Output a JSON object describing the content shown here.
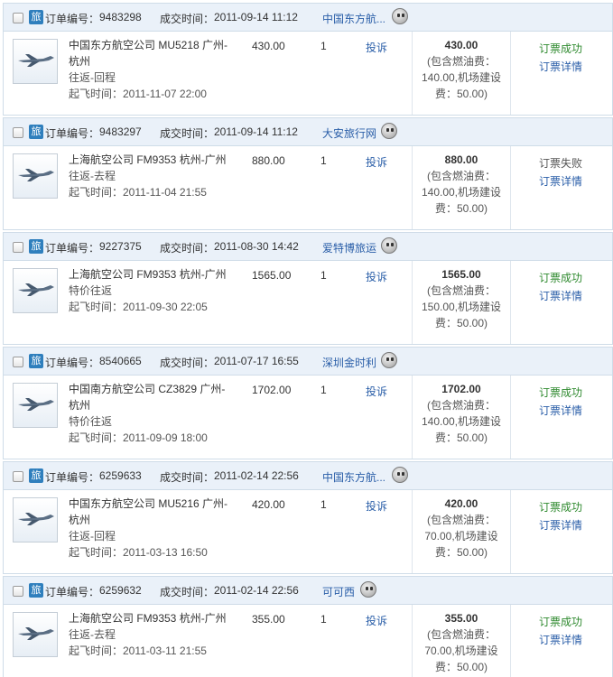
{
  "labels": {
    "order_no": "订单编号：",
    "deal_time": "成交时间：",
    "complain": "投诉",
    "detail": "订票详情",
    "travel_tag": "旅",
    "fuel_prefix": "(包含燃油费：",
    "airport_prefix": "机场建设",
    "airport_tail": "费：50.00)"
  },
  "orders": [
    {
      "order_no": "9483298",
      "deal_time": "2011-09-14 11:12",
      "agent": "中国东方航...",
      "flight_line1": "中国东方航空公司 MU5218 广州-",
      "flight_line2": "杭州",
      "trip": "往返-回程",
      "departure": "起飞时间：2011-11-07 22:00",
      "price": "430.00",
      "qty": "1",
      "total": "430.00",
      "fuel_line": "140.00,机场建设",
      "status": "订票成功"
    },
    {
      "order_no": "9483297",
      "deal_time": "2011-09-14 11:12",
      "agent": "大安旅行网",
      "flight_line1": "上海航空公司 FM9353 杭州-广州",
      "flight_line2": "",
      "trip": "往返-去程",
      "departure": "起飞时间：2011-11-04 21:55",
      "price": "880.00",
      "qty": "1",
      "total": "880.00",
      "fuel_line": "140.00,机场建设",
      "status": "订票失败"
    },
    {
      "order_no": "9227375",
      "deal_time": "2011-08-30 14:42",
      "agent": "爱特博旅运",
      "flight_line1": "上海航空公司 FM9353 杭州-广州",
      "flight_line2": "",
      "trip": "特价往返",
      "departure": "起飞时间：2011-09-30 22:05",
      "price": "1565.00",
      "qty": "1",
      "total": "1565.00",
      "fuel_line": "150.00,机场建设",
      "status": "订票成功"
    },
    {
      "order_no": "8540665",
      "deal_time": "2011-07-17 16:55",
      "agent": "深圳金时利",
      "flight_line1": "中国南方航空公司 CZ3829 广州-",
      "flight_line2": "杭州",
      "trip": "特价往返",
      "departure": "起飞时间：2011-09-09 18:00",
      "price": "1702.00",
      "qty": "1",
      "total": "1702.00",
      "fuel_line": "140.00,机场建设",
      "status": "订票成功"
    },
    {
      "order_no": "6259633",
      "deal_time": "2011-02-14 22:56",
      "agent": "中国东方航...",
      "flight_line1": "中国东方航空公司 MU5216 广州-",
      "flight_line2": "杭州",
      "trip": "往返-回程",
      "departure": "起飞时间：2011-03-13 16:50",
      "price": "420.00",
      "qty": "1",
      "total": "420.00",
      "fuel_line": "70.00,机场建设",
      "status": "订票成功"
    },
    {
      "order_no": "6259632",
      "deal_time": "2011-02-14 22:56",
      "agent": "可可西",
      "flight_line1": "上海航空公司 FM9353 杭州-广州",
      "flight_line2": "",
      "trip": "往返-去程",
      "departure": "起飞时间：2011-03-11 21:55",
      "price": "355.00",
      "qty": "1",
      "total": "355.00",
      "fuel_line": "70.00,机场建设",
      "status": "订票成功"
    }
  ],
  "colors": {
    "header_bg": "#eaf1f9",
    "link": "#2a5ea8",
    "success": "#2f8a2f",
    "tag": "#2f7fbd"
  }
}
